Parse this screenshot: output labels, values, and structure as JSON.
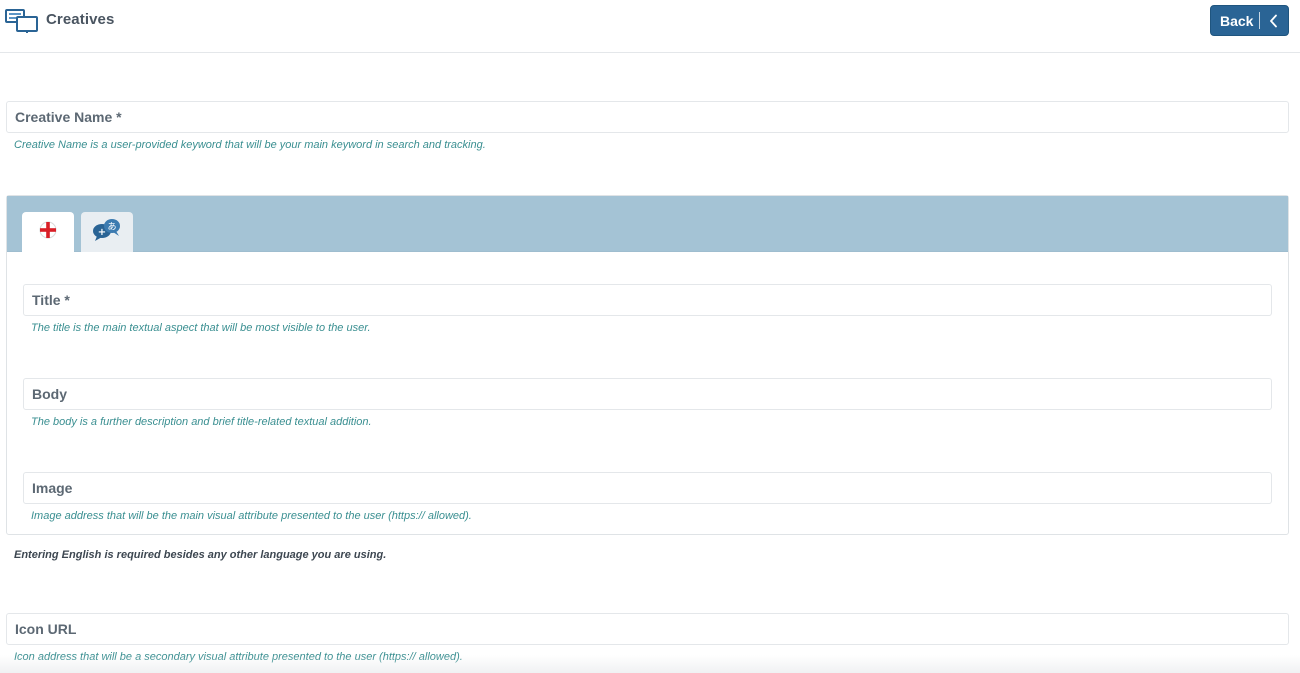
{
  "header": {
    "title": "Creatives",
    "back_label": "Back"
  },
  "creative_name": {
    "label": "Creative Name *",
    "help": "Creative Name is a user-provided keyword that will be your main keyword in search and tracking."
  },
  "language_tabs": [
    {
      "name": "english-flag-icon",
      "active": true
    },
    {
      "name": "translate-icon",
      "active": false
    }
  ],
  "title_field": {
    "label": "Title *",
    "help": "The title is the main textual aspect that will be most visible to the user."
  },
  "body_field": {
    "label": "Body",
    "help": "The body is a further description and brief title-related textual addition."
  },
  "image_field": {
    "label": "Image",
    "help": "Image address that will be the main visual attribute presented to the user (https:// allowed)."
  },
  "language_note": "Entering English is required besides any other language you are using.",
  "icon_url_field": {
    "label": "Icon URL",
    "help": "Icon address that will be a secondary visual attribute presented to the user (https:// allowed)."
  },
  "colors": {
    "accent": "#2a6495",
    "help_text": "#3a8f91",
    "tab_strip": "#a4c3d5"
  }
}
